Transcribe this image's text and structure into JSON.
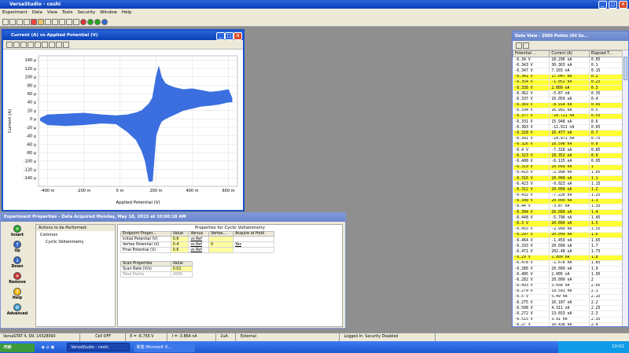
{
  "app": {
    "title": "VersaStudio - ceshi",
    "menu": [
      "Experiment",
      "Data",
      "View",
      "Tools",
      "Security",
      "Window",
      "Help"
    ]
  },
  "graph": {
    "title": "Current (A) vs Applied Potential (V)"
  },
  "chart_data": {
    "type": "line",
    "title": "",
    "xlabel": "Applied Potential (V)",
    "ylabel": "Current (A)",
    "xlim": [
      -450,
      650
    ],
    "ylim": [
      -160,
      150
    ],
    "xticks": [
      "-400 m",
      "-200 m",
      "0 m",
      "200 m",
      "400 m",
      "600 m"
    ],
    "xtick_values": [
      -400,
      -200,
      0,
      200,
      400,
      600
    ],
    "yticks": [
      "140 µ",
      "120 µ",
      "100 µ",
      "80 µ",
      "60 µ",
      "40 µ",
      "20 µ",
      "0 µ",
      "-20 µ",
      "-40 µ",
      "-60 µ",
      "-80 µ",
      "-100 µ",
      "-120 µ",
      "-140 µ"
    ],
    "ytick_values": [
      140,
      120,
      100,
      80,
      60,
      40,
      20,
      0,
      -20,
      -40,
      -60,
      -80,
      -100,
      -120,
      -140
    ],
    "grid": true,
    "color": "#3b6fe0",
    "upper_envelope": {
      "x": [
        -440,
        -400,
        -300,
        -200,
        -100,
        -20,
        40,
        90,
        120,
        140,
        160,
        180,
        200,
        215,
        230,
        250,
        270,
        300,
        350,
        400,
        450,
        500,
        550,
        600,
        620
      ],
      "y": [
        2,
        10,
        12,
        14,
        10,
        8,
        10,
        15,
        20,
        28,
        36,
        50,
        100,
        125,
        100,
        85,
        80,
        75,
        70,
        72,
        68,
        64,
        66,
        70,
        50
      ]
    },
    "lower_envelope": {
      "x": [
        -440,
        -400,
        -300,
        -200,
        -100,
        -20,
        40,
        90,
        120,
        140,
        160,
        180,
        200,
        215,
        230,
        250,
        270,
        300,
        350,
        400,
        450,
        500,
        550,
        600,
        620
      ],
      "y": [
        -4,
        -14,
        -16,
        -14,
        -10,
        -12,
        -30,
        -50,
        -75,
        -100,
        -148,
        -148,
        -40,
        -20,
        -6,
        0,
        4,
        10,
        20,
        25,
        30,
        32,
        35,
        40,
        40
      ]
    }
  },
  "experiment": {
    "title": "Experiment Properties - Data Acquired Monday, May 18, 2015 at 10:00:18 AM",
    "actions_label": "Actions to be Performed:",
    "tree": [
      "Common",
      "Cyclic Voltammetry"
    ],
    "nav": [
      "Insert",
      "Up",
      "Down",
      "Remove",
      "Help",
      "Advanced"
    ],
    "props_title": "Properties for Cyclic Voltammetry",
    "endpoint_headers": [
      "Endpoint Proper...",
      "Value",
      "Versus",
      "Vertex...",
      "Acquire at Hold"
    ],
    "endpoints": [
      {
        "name": "Initial Potential (V)",
        "value": "0.6",
        "versus": "vs Ref",
        "vertex": "",
        "acquire": ""
      },
      {
        "name": "Vertex Potential (V)",
        "value": "0.4",
        "versus": "vs Ref",
        "vertex": "0",
        "acquire": "Yes"
      },
      {
        "name": "Final Potential (V)",
        "value": "0.6",
        "versus": "vs Ref",
        "vertex": "",
        "acquire": ""
      }
    ],
    "scan_headers": [
      "Scan Properties",
      "Value"
    ],
    "scan": [
      {
        "name": "Scan Rate (V/s)",
        "value": "0.02"
      },
      {
        "name": "Total Points",
        "value": "2000"
      }
    ]
  },
  "dataview": {
    "title": "Data View - 2000 Points (All Se...",
    "headers": [
      "Potential ...",
      "Current (A)",
      "Elapsed T..."
    ],
    "rows": [
      [
        "-6.34  V",
        "18.296 nA",
        "0.05",
        0
      ],
      [
        "-6.343  V",
        "30.363 nA",
        "0.1",
        0
      ],
      [
        "-6.347  V",
        "7.103 nA",
        "0.15",
        0
      ],
      [
        "-6.341  V",
        "17.047 nA",
        "0.2",
        1
      ],
      [
        "-6.354  V",
        "-1.052 nA",
        "0.25",
        1
      ],
      [
        "-6.338  V",
        "2.009 nA",
        "0.3",
        1
      ],
      [
        "-6.362  V",
        "-5.87 nA",
        "0.35",
        0
      ],
      [
        "-6.337  V",
        "16.059 nA",
        "0.4",
        0
      ],
      [
        "-6.369  V",
        "-8.914 nA",
        "0.45",
        1
      ],
      [
        "-6.334  V",
        "16.992 nA",
        "0.5",
        0
      ],
      [
        "-6.377  V",
        "-10.721 nA",
        "0.55",
        1
      ],
      [
        "-6.331  V",
        "15.948 nA",
        "0.6",
        0
      ],
      [
        "-6.383  V",
        "-12.911 nA",
        "0.65",
        0
      ],
      [
        "-6.328  V",
        "16.477 nA",
        "0.7",
        1
      ],
      [
        "-6.391  V",
        "-14.971 nA",
        "0.75",
        0
      ],
      [
        "-6.326  V",
        "18.598 nA",
        "0.8",
        1
      ],
      [
        "-6.4  V",
        "-7.318 nA",
        "0.85",
        0
      ],
      [
        "-6.323  V",
        "18.352 nA",
        "0.9",
        1
      ],
      [
        "-6.408  V",
        "-6.115 nA",
        "0.95",
        0
      ],
      [
        "-6.319  V",
        "20.099 nA",
        "1",
        1
      ],
      [
        "-6.415  V",
        "-2.998 nA",
        "1.05",
        0
      ],
      [
        "-6.316  V",
        "20.099 nA",
        "1.1",
        1
      ],
      [
        "-6.423  V",
        "-9.023 nA",
        "1.15",
        0
      ],
      [
        "-6.312  V",
        "20.099 nA",
        "1.2",
        1
      ],
      [
        "-6.432  V",
        "-7.226 nA",
        "1.25",
        0
      ],
      [
        "-6.308  V",
        "20.099 nA",
        "1.3",
        1
      ],
      [
        "-6.44  V",
        "-3.87 nA",
        "1.35",
        0
      ],
      [
        "-6.304  V",
        "20.099 nA",
        "1.4",
        1
      ],
      [
        "-6.448  V",
        "-5.796 nA",
        "1.45",
        0
      ],
      [
        "-6.3  V",
        "20.099 nA",
        "1.5",
        1
      ],
      [
        "-6.455  V",
        "-2.999 nA",
        "1.55",
        0
      ],
      [
        "-6.297  V",
        "20.099 nA",
        "1.6",
        1
      ],
      [
        "-6.464  V",
        "-1.459 nA",
        "1.65",
        0
      ],
      [
        "-6.293  V",
        "20.099 nA",
        "1.7",
        0
      ],
      [
        "-6.471  V",
        "202.48 nA",
        "1.75",
        0
      ],
      [
        "-6.29  V",
        "2.009 nA",
        "1.8",
        1
      ],
      [
        "-6.478  V",
        "-1.678 nA",
        "1.85",
        0
      ],
      [
        "-6.286  V",
        "20.099 nA",
        "1.9",
        0
      ],
      [
        "-6.485  V",
        "2.005 nA",
        "1.95",
        0
      ],
      [
        "-6.282  V",
        "20.099 nA",
        "2",
        0
      ],
      [
        "-6.493  V",
        "3.058 nA",
        "2.05",
        0
      ],
      [
        "-6.279  V",
        "19.591 nA",
        "2.1",
        0
      ],
      [
        "-6.5  V",
        "5.49 nA",
        "2.15",
        0
      ],
      [
        "-6.275  V",
        "16.107 nA",
        "2.2",
        0
      ],
      [
        "-6.508  V",
        "4.311 nA",
        "2.25",
        0
      ],
      [
        "-6.272  V",
        "13.653 nA",
        "2.3",
        0
      ],
      [
        "-6.515  V",
        "3.91 nA",
        "2.35",
        0
      ],
      [
        "-6.27  V",
        "10.438 nA",
        "2.4",
        0
      ],
      [
        "-6.521  V",
        "7.352 nA",
        "2.45",
        0
      ],
      [
        "-6.266  V",
        "7.417 nA",
        "2.5",
        0
      ]
    ]
  },
  "status": {
    "instrument": "VersaSTAT 4, SN: 14328090",
    "cell": "Cell OFF",
    "potential": "E = -6.756 V",
    "current": "I = -3.864 nA",
    "range": "2uA",
    "mode": "External",
    "login": "Logged In: Security Disabled"
  },
  "taskbar": {
    "start": "开始",
    "tasks": [
      "VersaStudio - ceshi",
      "新建 Microsoft D..."
    ],
    "clock": "10:02"
  }
}
